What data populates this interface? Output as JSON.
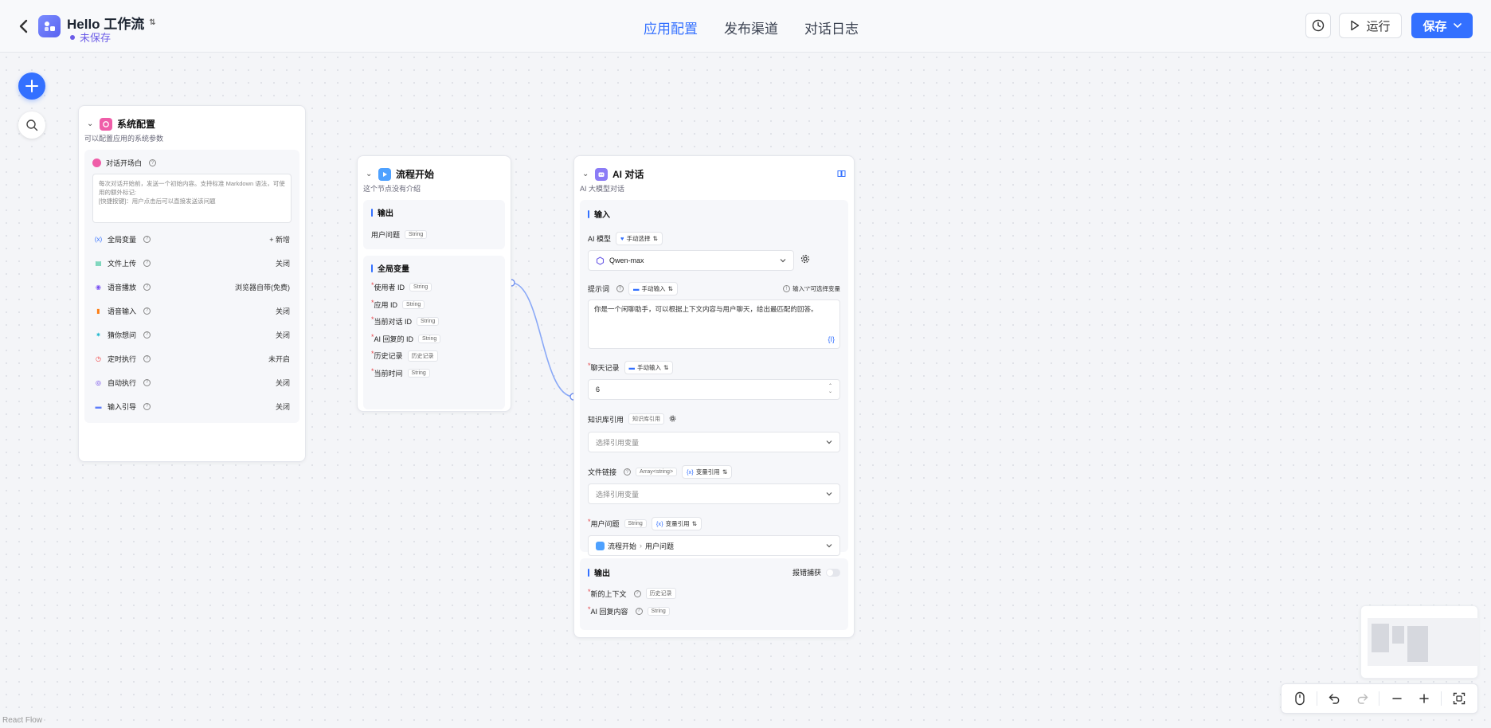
{
  "header": {
    "app_title": "Hello 工作流",
    "status": "未保存",
    "tabs": [
      {
        "label": "应用配置",
        "active": true
      },
      {
        "label": "发布渠道",
        "active": false
      },
      {
        "label": "对话日志",
        "active": false
      }
    ],
    "run_label": "运行",
    "save_label": "保存"
  },
  "system_node": {
    "title": "系统配置",
    "desc": "可以配置应用的系统参数",
    "opening_label": "对话开场白",
    "opening_placeholder": "每次对话开始前，发送一个初始内容。支持标准 Markdown 语法，可使用的额外标记:\n[快捷按键]：用户点击后可以直接发送该问题",
    "rows": [
      {
        "label": "全局变量",
        "value": "+ 新增",
        "icon": "variable-icon",
        "color": "#3370ff"
      },
      {
        "label": "文件上传",
        "value": "关闭",
        "icon": "file-icon",
        "color": "#12b886"
      },
      {
        "label": "语音播放",
        "value": "浏览器自带(免费)",
        "icon": "broadcast-icon",
        "color": "#7950f2"
      },
      {
        "label": "语音输入",
        "value": "关闭",
        "icon": "mic-icon",
        "color": "#fd7e14"
      },
      {
        "label": "猜你想问",
        "value": "关闭",
        "icon": "bulb-icon",
        "color": "#22b8cf"
      },
      {
        "label": "定时执行",
        "value": "未开启",
        "icon": "clock-icon",
        "color": "#f03e3e"
      },
      {
        "label": "自动执行",
        "value": "关闭",
        "icon": "auto-icon",
        "color": "#7048e8"
      },
      {
        "label": "输入引导",
        "value": "关闭",
        "icon": "guide-icon",
        "color": "#5c7cfa"
      }
    ]
  },
  "start_node": {
    "title": "流程开始",
    "desc": "这个节点没有介绍",
    "output_title": "输出",
    "output_row": {
      "label": "用户问题",
      "type": "String"
    },
    "globals_title": "全局变量",
    "globals": [
      {
        "label": "使用者 ID",
        "type": "String"
      },
      {
        "label": "应用 ID",
        "type": "String"
      },
      {
        "label": "当前对话 ID",
        "type": "String"
      },
      {
        "label": "AI 回复的 ID",
        "type": "String"
      },
      {
        "label": "历史记录",
        "type": "历史记录"
      },
      {
        "label": "当前时间",
        "type": "String"
      }
    ]
  },
  "ai_node": {
    "title": "AI 对话",
    "desc": "AI 大模型对话",
    "input_title": "输入",
    "model_label": "AI 模型",
    "model_mode": "手动选择",
    "model_value": "Qwen-max",
    "prompt_label": "提示词",
    "prompt_mode": "手动输入",
    "prompt_hint": "输入\"/\"可选择变量",
    "prompt_value": "你是一个闲聊助手，可以根据上下文内容与用户聊天，给出最匹配的回答。",
    "history_label": "聊天记录",
    "history_mode": "手动输入",
    "history_value": "6",
    "kb_label": "知识库引用",
    "kb_tag": "知识库引用",
    "kb_placeholder": "选择引用变量",
    "file_label": "文件链接",
    "file_tag": "Array<string>",
    "file_mode": "变量引用",
    "file_placeholder": "选择引用变量",
    "question_label": "用户问题",
    "question_tag": "String",
    "question_mode": "变量引用",
    "question_source": "流程开始",
    "question_field": "用户问题",
    "output_title": "输出",
    "catch_label": "报错捕获",
    "outputs": [
      {
        "label": "新的上下文",
        "type": "历史记录"
      },
      {
        "label": "AI 回复内容",
        "type": "String"
      }
    ]
  },
  "footer": {
    "attribution": "React Flow"
  }
}
